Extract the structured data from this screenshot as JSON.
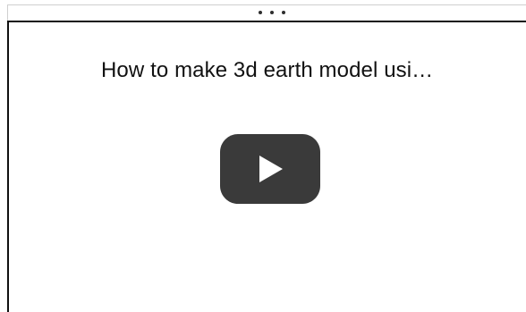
{
  "video": {
    "title": "How to make 3d earth model usi…",
    "play_icon": "play-icon",
    "menu_icon": "more-dots-icon"
  },
  "colors": {
    "border": "#111111",
    "topbar_border": "#cfcfcf",
    "play_button": "#3a3a3a",
    "play_arrow": "#ffffff"
  }
}
